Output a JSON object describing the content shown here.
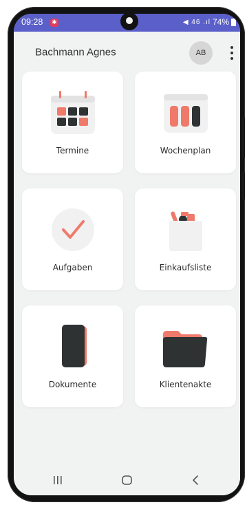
{
  "status_bar": {
    "time": "09:28",
    "notification_badge": "✱",
    "signal_icons": "◀ 46 .ıl",
    "battery": "74%"
  },
  "header": {
    "user_name": "Bachmann Agnes",
    "avatar_initials": "AB",
    "menu_icon": "more-vertical-icon"
  },
  "tiles": [
    {
      "label": "Termine",
      "icon": "calendar-icon"
    },
    {
      "label": "Wochenplan",
      "icon": "weekplan-icon"
    },
    {
      "label": "Aufgaben",
      "icon": "checkmark-icon"
    },
    {
      "label": "Einkaufsliste",
      "icon": "shopping-bag-icon"
    },
    {
      "label": "Dokumente",
      "icon": "document-icon"
    },
    {
      "label": "Klientenakte",
      "icon": "folder-icon"
    }
  ],
  "colors": {
    "accent": "#ef7a6b",
    "dark": "#2f3233",
    "status_bar": "#5b5fc9",
    "background": "#f1f2f2"
  },
  "nav_bar": {
    "recents_icon": "recents-icon",
    "home_icon": "home-icon",
    "back_icon": "back-icon"
  }
}
